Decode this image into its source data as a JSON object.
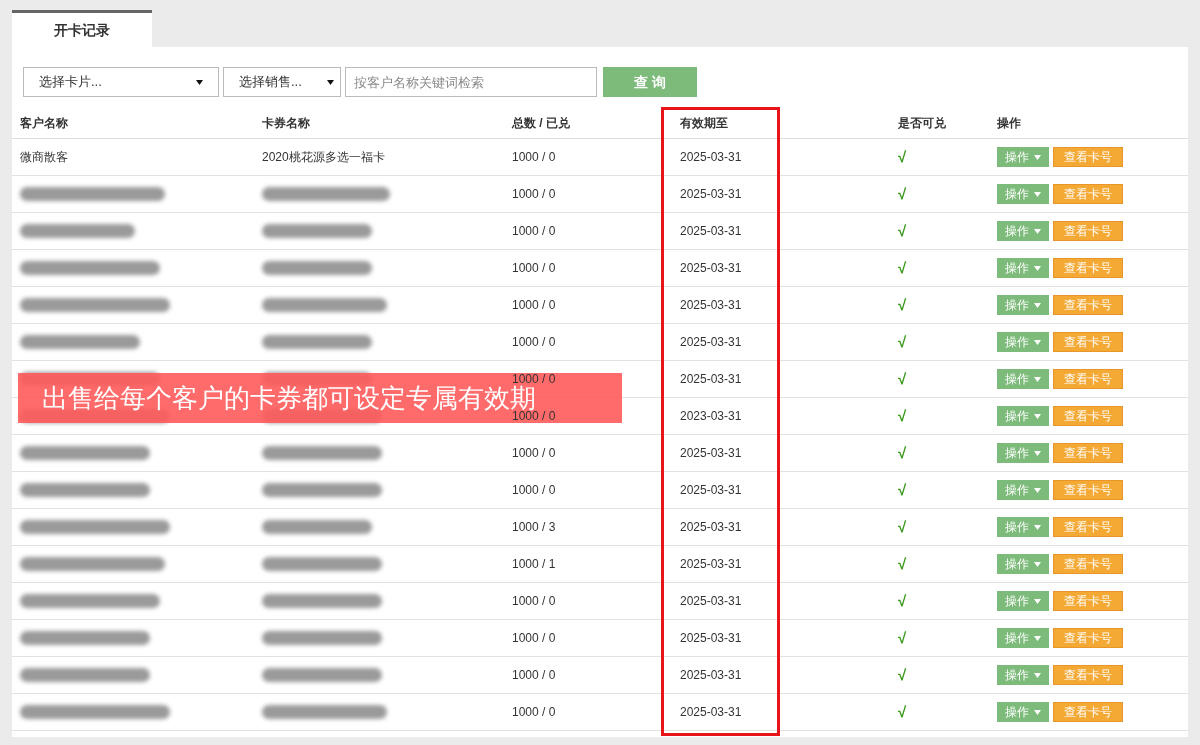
{
  "tabs": [
    {
      "label": "开卡记录",
      "selected": true
    }
  ],
  "filters": {
    "card_select": "选择卡片...",
    "seller_select": "选择销售...",
    "search": {
      "placeholder": "按客户名称关键词检索"
    },
    "query_button": "查 询"
  },
  "table": {
    "columns": [
      "客户名称",
      "卡券名称",
      "总数 / 已兑",
      "有效期至",
      "是否可兑",
      "操作"
    ],
    "rows": [
      {
        "customer": "微商散客",
        "card": "2020桃花源多选一福卡",
        "totals": "1000 / 0",
        "expiry": "2025-03-31",
        "redeemable": "√",
        "actions": [
          "操作",
          "查看卡号"
        ]
      },
      {
        "totals": "1000 / 0",
        "expiry": "2025-03-31",
        "redeemable": "√",
        "actions": [
          "操作",
          "查看卡号"
        ]
      },
      {
        "totals": "1000 / 0",
        "expiry": "2025-03-31",
        "redeemable": "√",
        "actions": [
          "操作",
          "查看卡号"
        ]
      },
      {
        "totals": "1000 / 0",
        "expiry": "2025-03-31",
        "redeemable": "√",
        "actions": [
          "操作",
          "查看卡号"
        ]
      },
      {
        "totals": "1000 / 0",
        "expiry": "2025-03-31",
        "redeemable": "√",
        "actions": [
          "操作",
          "查看卡号"
        ]
      },
      {
        "totals": "1000 / 0",
        "expiry": "2025-03-31",
        "redeemable": "√",
        "actions": [
          "操作",
          "查看卡号"
        ]
      },
      {
        "totals": "1000 / 0",
        "expiry": "2025-03-31",
        "redeemable": "√",
        "actions": [
          "操作",
          "查看卡号"
        ]
      },
      {
        "totals": "1000 / 0",
        "expiry": "2023-03-31",
        "redeemable": "√",
        "actions": [
          "操作",
          "查看卡号"
        ]
      },
      {
        "totals": "1000 / 0",
        "expiry": "2025-03-31",
        "redeemable": "√",
        "actions": [
          "操作",
          "查看卡号"
        ]
      },
      {
        "totals": "1000 / 0",
        "expiry": "2025-03-31",
        "redeemable": "√",
        "actions": [
          "操作",
          "查看卡号"
        ]
      },
      {
        "totals": "1000 / 3",
        "expiry": "2025-03-31",
        "redeemable": "√",
        "actions": [
          "操作",
          "查看卡号"
        ]
      },
      {
        "totals": "1000 / 1",
        "expiry": "2025-03-31",
        "redeemable": "√",
        "actions": [
          "操作",
          "查看卡号"
        ]
      },
      {
        "totals": "1000 / 0",
        "expiry": "2025-03-31",
        "redeemable": "√",
        "actions": [
          "操作",
          "查看卡号"
        ]
      },
      {
        "totals": "1000 / 0",
        "expiry": "2025-03-31",
        "redeemable": "√",
        "actions": [
          "操作",
          "查看卡号"
        ]
      },
      {
        "totals": "1000 / 0",
        "expiry": "2025-03-31",
        "redeemable": "√",
        "actions": [
          "操作",
          "查看卡号"
        ]
      },
      {
        "totals": "1000 / 0",
        "expiry": "2025-03-31",
        "redeemable": "√",
        "actions": [
          "操作",
          "查看卡号"
        ]
      }
    ]
  },
  "banner": "出售给每个客户的卡券都可设定专属有效期"
}
